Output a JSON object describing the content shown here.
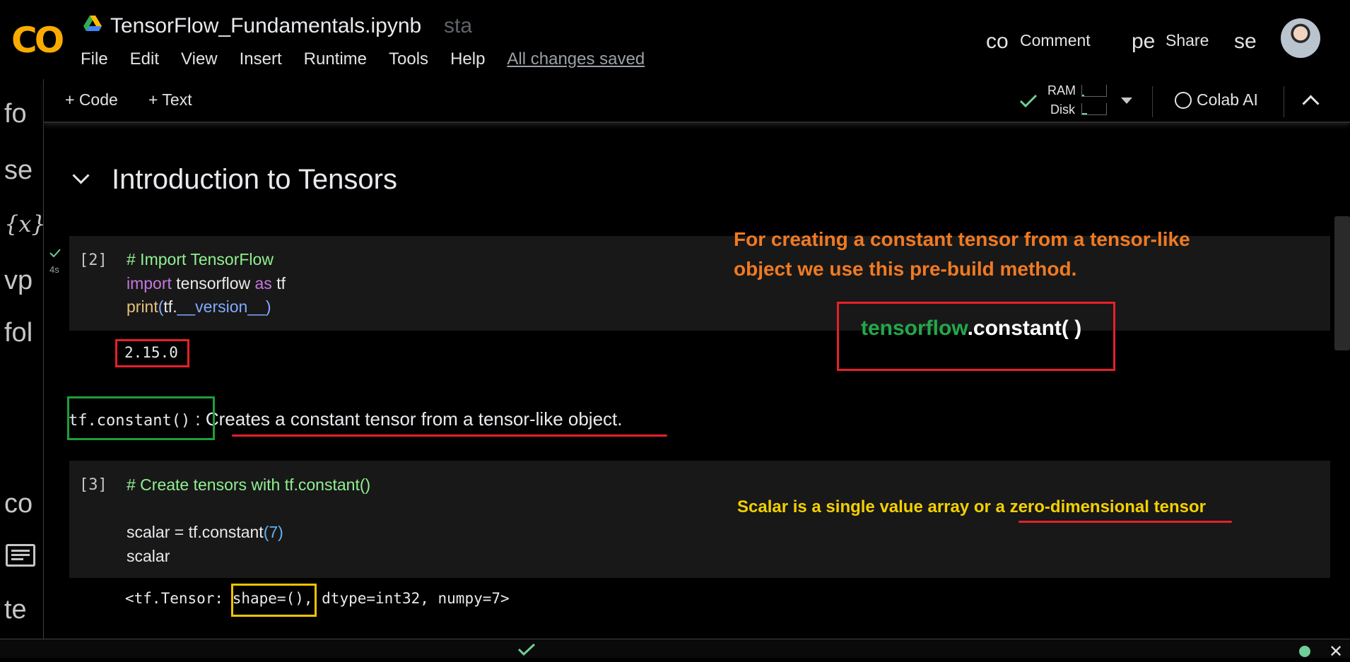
{
  "header": {
    "logo_text": "CO",
    "notebook_title": "TensorFlow_Fundamentals.ipynb",
    "star_fragment": "sta",
    "menu": [
      "File",
      "Edit",
      "View",
      "Insert",
      "Runtime",
      "Tools",
      "Help"
    ],
    "save_status": "All changes saved",
    "comment_prefix": "co",
    "comment_label": "Comment",
    "share_prefix": "pe",
    "share_label": "Share",
    "settings_fragment": "se"
  },
  "left_rail": [
    "fo",
    "se",
    "{x}",
    "vp",
    "fol",
    "co",
    "te"
  ],
  "toolbar": {
    "add_code": "+ Code",
    "add_text": "+ Text",
    "ram_label": "RAM",
    "disk_label": "Disk",
    "ram_usage": 0.1,
    "disk_usage": 0.2,
    "colab_ai_label": "Colab AI"
  },
  "notebook": {
    "section_title": "Introduction to Tensors",
    "cells": [
      {
        "exec_count": "[2]",
        "run_time": "4s",
        "lines": {
          "l1": "# Import TensorFlow",
          "l2_kw": "import",
          "l2_mod": " tensorflow ",
          "l2_as": "as",
          "l2_alias": " tf",
          "l3_fn": "print",
          "l3_open": "(",
          "l3_obj": "tf.",
          "l3_attr": "__version__",
          "l3_close": ")"
        },
        "output": "2.15.0"
      },
      {
        "exec_count": "[3]",
        "lines": {
          "l1": "# Create tensors with tf.constant()",
          "l2_pre": "scalar = tf.constant",
          "l2_open": "(",
          "l2_num": "7",
          "l2_close": ")",
          "l3": "scalar"
        },
        "output_pre": "<tf.Tensor: ",
        "output_shape": "shape=()",
        "output_post": ", dtype=int32, numpy=7>"
      }
    ],
    "markdown": {
      "code": "tf.constant()",
      "text": ": Creates a constant tensor from a tensor-like object."
    }
  },
  "annotations": {
    "orange_note_line1": "For creating a constant tensor from a tensor-like",
    "orange_note_line2": "object we use this pre-build method.",
    "api_prefix": "tensorflow",
    "api_suffix": ".constant( )",
    "yellow_note_prefix": "Scalar is a single value array or a ",
    "yellow_note_emphasis": "zero-dimensional tensor"
  },
  "colors": {
    "logo": "#f9ab00",
    "annotation_red": "#e6202a",
    "annotation_green": "#1e9e3a",
    "annotation_yellow": "#f2c200",
    "note_orange": "#f07a22"
  },
  "icons": [
    "drive-icon",
    "avatar",
    "check-icon",
    "dropdown-icon",
    "colab-ai-icon",
    "chevron-up-icon",
    "chevron-down-icon",
    "terminal-icon",
    "close-icon"
  ]
}
